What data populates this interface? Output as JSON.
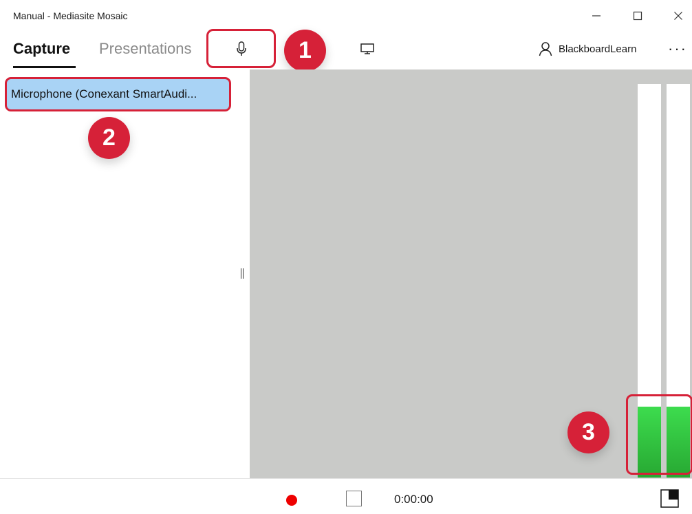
{
  "window": {
    "title": "Manual - Mediasite Mosaic",
    "controls": {
      "minimize_icon": "minimize-icon",
      "maximize_icon": "maximize-icon",
      "close_icon": "close-icon"
    }
  },
  "toolbar": {
    "tabs": [
      {
        "label": "Capture",
        "active": true
      },
      {
        "label": "Presentations",
        "active": false
      }
    ],
    "microphone_icon": "microphone-icon",
    "screen_icon": "monitor-icon",
    "user": {
      "icon": "user-icon",
      "label": "BlackboardLearn"
    },
    "more_label": "···"
  },
  "callouts": [
    "1",
    "2",
    "3"
  ],
  "devices": {
    "selected_label": "Microphone (Conexant SmartAudi..."
  },
  "audio_meter": {
    "left_level": 0.18,
    "right_level": 0.18
  },
  "bottom": {
    "timer": "0:00:00",
    "record_icon": "record-icon",
    "stop_icon": "stop-icon",
    "layout_icon": "layout-icon"
  },
  "colors": {
    "accent_red": "#d62138",
    "selection_blue": "#a9d3f5",
    "meter_green": "#33c444",
    "preview_gray": "#c9cac8"
  }
}
